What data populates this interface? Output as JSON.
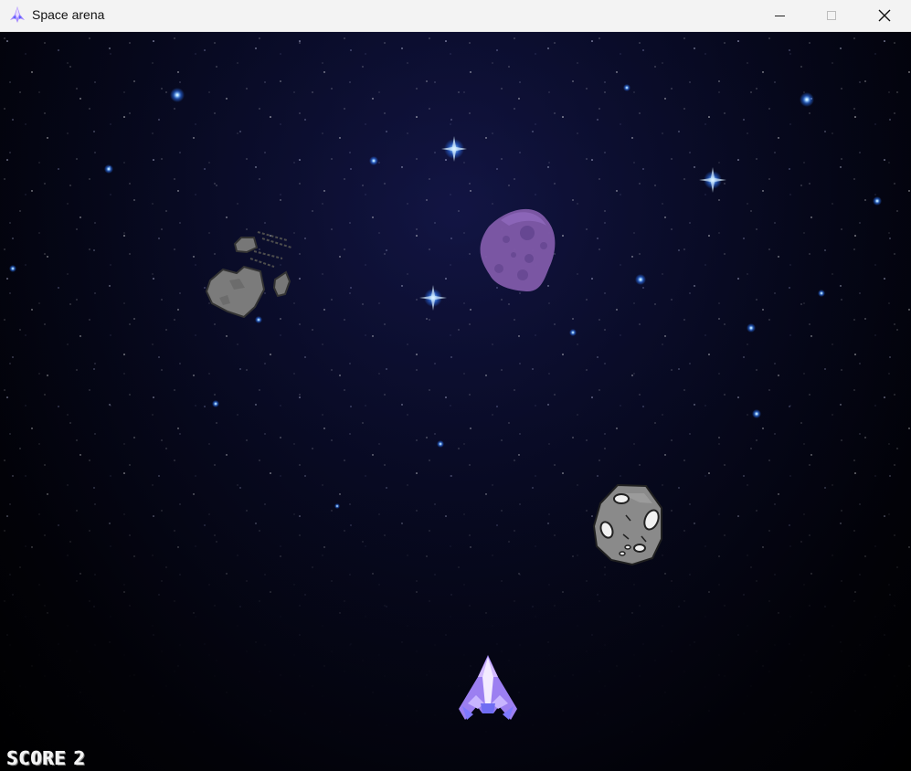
{
  "window": {
    "title": "Space arena",
    "controls": {
      "minimize": "minimize",
      "maximize": "maximize",
      "close": "close"
    }
  },
  "hud": {
    "score_label": "SCORE",
    "score_value": "2"
  },
  "sprites": {
    "player": "spaceship-icon",
    "asteroids": [
      "purple-asteroid",
      "gray-asteroid",
      "broken-asteroid"
    ]
  },
  "colors": {
    "space_blue": "#0b1033",
    "purple_asteroid": "#8a5fb2",
    "gray_asteroid": "#8c8c8c",
    "ship_lavender": "#b493ff",
    "ship_blue": "#7f82ff"
  }
}
